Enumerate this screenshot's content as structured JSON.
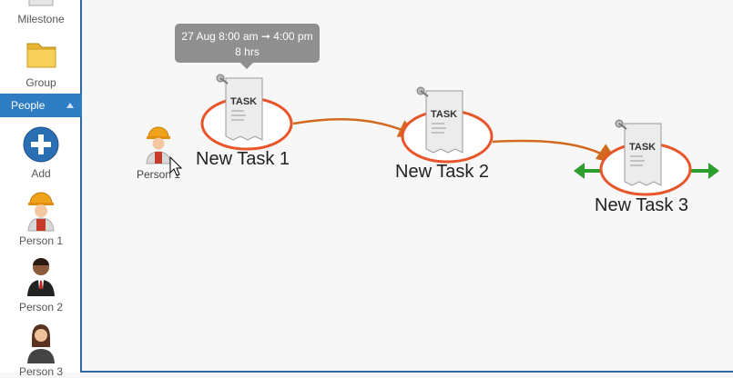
{
  "sidebar": {
    "milestone_label": "Milestone",
    "group_label": "Group",
    "people_header": "People",
    "add_label": "Add",
    "persons": [
      "Person 1",
      "Person 2",
      "Person 3"
    ]
  },
  "canvas": {
    "tooltip": {
      "time": "27 Aug 8:00 am ➞ 4:00 pm",
      "duration": "8 hrs"
    },
    "tasks": [
      {
        "label": "New Task 1",
        "doc_title": "TASK"
      },
      {
        "label": "New Task 2",
        "doc_title": "TASK"
      },
      {
        "label": "New Task 3",
        "doc_title": "TASK"
      }
    ],
    "person_label": "Person 1"
  },
  "colors": {
    "accent": "#2e7dc2",
    "ring": "#e8552a",
    "connector": "#d2691e",
    "handle": "#2e9e2e",
    "tooltip": "#8f8f8f"
  }
}
